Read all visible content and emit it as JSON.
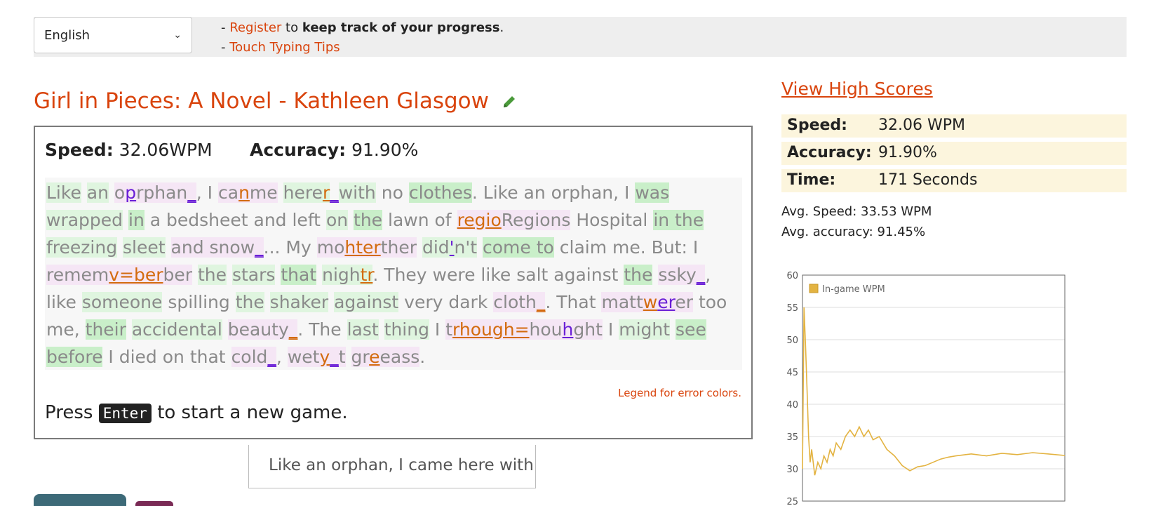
{
  "header": {
    "language": "English",
    "promo_line1_prefix": "- ",
    "promo_register": "Register",
    "promo_mid": " to ",
    "promo_bold": "keep track of your progress",
    "promo_end": ".",
    "promo_line2_prefix": "- ",
    "promo_tips": "Touch Typing Tips"
  },
  "book": {
    "title": "Girl in Pieces: A Novel - Kathleen Glasgow"
  },
  "game": {
    "speed_label": "Speed:",
    "speed_value": "32.06WPM",
    "accuracy_label": "Accuracy:",
    "accuracy_value": "91.90%",
    "legend_link": "Legend for error colors.",
    "press_prefix": "Press",
    "press_key": "Enter",
    "press_suffix": "to start a new game.",
    "input_value": "Like an orphan, I came here with"
  },
  "results": {
    "high_scores_link": "View High Scores",
    "speed_label": "Speed:",
    "speed_value": "32.06 WPM",
    "accuracy_label": "Accuracy:",
    "accuracy_value": "91.90%",
    "time_label": "Time:",
    "time_value": "171 Seconds",
    "avg_speed": "Avg. Speed: 33.53 WPM",
    "avg_accuracy": "Avg. accuracy: 91.45%"
  },
  "colors": {
    "accent": "#d9440d",
    "correct": "#dff5df",
    "error_purple": "#6a1fd6",
    "error_orange": "#d36b0f",
    "chart_line": "#e3b341"
  },
  "chart_data": {
    "type": "line",
    "title": "",
    "xlabel": "",
    "ylabel": "",
    "ylim": [
      25,
      60
    ],
    "yticks": [
      25,
      30,
      35,
      40,
      45,
      50,
      55,
      60
    ],
    "grid": true,
    "legend_position": "top-left",
    "series": [
      {
        "name": "In-game WPM",
        "x": [
          0,
          1,
          2,
          3,
          4,
          5,
          6,
          8,
          10,
          12,
          14,
          16,
          18,
          20,
          22,
          25,
          28,
          31,
          34,
          37,
          40,
          43,
          46,
          50,
          55,
          60,
          65,
          70,
          75,
          80,
          85,
          90,
          95,
          100,
          110,
          120,
          130,
          140,
          150,
          160,
          171
        ],
        "values": [
          30,
          55,
          49,
          42,
          35,
          31,
          33,
          29,
          31,
          30,
          32,
          31,
          33,
          32,
          34,
          33,
          35,
          36,
          35,
          36.5,
          35,
          36,
          34.5,
          35,
          33,
          32,
          30.5,
          29.7,
          30.3,
          30.5,
          31,
          31.5,
          31.8,
          32,
          32.3,
          32,
          32.4,
          32.2,
          32.5,
          32.3,
          32.06
        ]
      }
    ]
  }
}
